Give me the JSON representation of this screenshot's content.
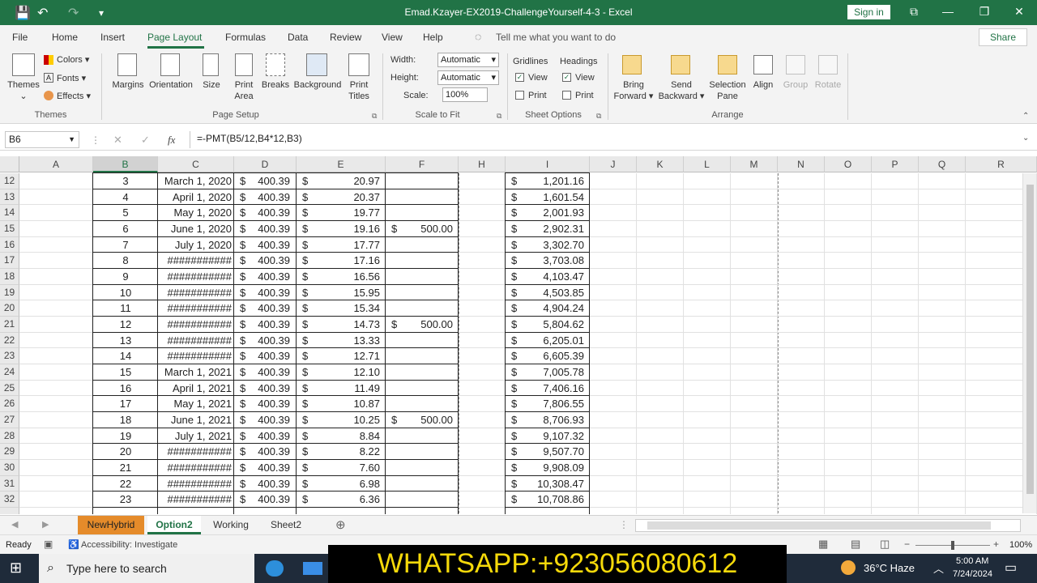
{
  "window": {
    "title": "Emad.Kzayer-EX2019-ChallengeYourself-4-3  -  Excel",
    "sign_in": "Sign in"
  },
  "tabs": [
    "File",
    "Home",
    "Insert",
    "Page Layout",
    "Formulas",
    "Data",
    "Review",
    "View",
    "Help"
  ],
  "tell_me": "Tell me what you want to do",
  "share": "Share",
  "ribbon": {
    "themes": {
      "themes": "Themes",
      "colors": "Colors",
      "fonts": "Fonts",
      "effects": "Effects",
      "group": "Themes"
    },
    "page_setup": {
      "margins": "Margins",
      "orientation": "Orientation",
      "size": "Size",
      "print_area_1": "Print",
      "print_area_2": "Area",
      "breaks": "Breaks",
      "background": "Background",
      "print_titles_1": "Print",
      "print_titles_2": "Titles",
      "group": "Page Setup"
    },
    "scale": {
      "width_label": "Width:",
      "width_value": "Automatic",
      "height_label": "Height:",
      "height_value": "Automatic",
      "scale_label": "Scale:",
      "scale_value": "100%",
      "group": "Scale to Fit"
    },
    "sheet_options": {
      "gridlines": "Gridlines",
      "headings": "Headings",
      "view": "View",
      "print": "Print",
      "group": "Sheet Options"
    },
    "arrange": {
      "bring_1": "Bring",
      "bring_2": "Forward",
      "send_1": "Send",
      "send_2": "Backward",
      "selection_1": "Selection",
      "selection_2": "Pane",
      "align": "Align",
      "group_btn": "Group",
      "rotate": "Rotate",
      "group": "Arrange"
    }
  },
  "formula_bar": {
    "name_box": "B6",
    "formula": "=-PMT(B5/12,B4*12,B3)",
    "cancel": "✕",
    "enter": "✓",
    "fx": "fx"
  },
  "columns": [
    "A",
    "B",
    "C",
    "D",
    "E",
    "F",
    "H",
    "I",
    "J",
    "K",
    "L",
    "M",
    "N",
    "O",
    "P",
    "Q",
    "R"
  ],
  "rows": [
    {
      "r": "12",
      "b": "3",
      "c": "March 1, 2020",
      "d": "400.39",
      "e": "20.97",
      "f": "",
      "i": "1,201.16"
    },
    {
      "r": "13",
      "b": "4",
      "c": "April 1, 2020",
      "d": "400.39",
      "e": "20.37",
      "f": "",
      "i": "1,601.54"
    },
    {
      "r": "14",
      "b": "5",
      "c": "May 1, 2020",
      "d": "400.39",
      "e": "19.77",
      "f": "",
      "i": "2,001.93"
    },
    {
      "r": "15",
      "b": "6",
      "c": "June 1, 2020",
      "d": "400.39",
      "e": "19.16",
      "f": "500.00",
      "i": "2,902.31"
    },
    {
      "r": "16",
      "b": "7",
      "c": "July 1, 2020",
      "d": "400.39",
      "e": "17.77",
      "f": "",
      "i": "3,302.70"
    },
    {
      "r": "17",
      "b": "8",
      "c": "###########",
      "d": "400.39",
      "e": "17.16",
      "f": "",
      "i": "3,703.08"
    },
    {
      "r": "18",
      "b": "9",
      "c": "###########",
      "d": "400.39",
      "e": "16.56",
      "f": "",
      "i": "4,103.47"
    },
    {
      "r": "19",
      "b": "10",
      "c": "###########",
      "d": "400.39",
      "e": "15.95",
      "f": "",
      "i": "4,503.85"
    },
    {
      "r": "20",
      "b": "11",
      "c": "###########",
      "d": "400.39",
      "e": "15.34",
      "f": "",
      "i": "4,904.24"
    },
    {
      "r": "21",
      "b": "12",
      "c": "###########",
      "d": "400.39",
      "e": "14.73",
      "f": "500.00",
      "i": "5,804.62"
    },
    {
      "r": "22",
      "b": "13",
      "c": "###########",
      "d": "400.39",
      "e": "13.33",
      "f": "",
      "i": "6,205.01"
    },
    {
      "r": "23",
      "b": "14",
      "c": "###########",
      "d": "400.39",
      "e": "12.71",
      "f": "",
      "i": "6,605.39"
    },
    {
      "r": "24",
      "b": "15",
      "c": "March 1, 2021",
      "d": "400.39",
      "e": "12.10",
      "f": "",
      "i": "7,005.78"
    },
    {
      "r": "25",
      "b": "16",
      "c": "April 1, 2021",
      "d": "400.39",
      "e": "11.49",
      "f": "",
      "i": "7,406.16"
    },
    {
      "r": "26",
      "b": "17",
      "c": "May 1, 2021",
      "d": "400.39",
      "e": "10.87",
      "f": "",
      "i": "7,806.55"
    },
    {
      "r": "27",
      "b": "18",
      "c": "June 1, 2021",
      "d": "400.39",
      "e": "10.25",
      "f": "500.00",
      "i": "8,706.93"
    },
    {
      "r": "28",
      "b": "19",
      "c": "July 1, 2021",
      "d": "400.39",
      "e": "8.84",
      "f": "",
      "i": "9,107.32"
    },
    {
      "r": "29",
      "b": "20",
      "c": "###########",
      "d": "400.39",
      "e": "8.22",
      "f": "",
      "i": "9,507.70"
    },
    {
      "r": "30",
      "b": "21",
      "c": "###########",
      "d": "400.39",
      "e": "7.60",
      "f": "",
      "i": "9,908.09"
    },
    {
      "r": "31",
      "b": "22",
      "c": "###########",
      "d": "400.39",
      "e": "6.98",
      "f": "",
      "i": "10,308.47"
    },
    {
      "r": "32",
      "b": "23",
      "c": "###########",
      "d": "400.39",
      "e": "6.36",
      "f": "",
      "i": "10,708.86"
    }
  ],
  "currency": "$",
  "sheets": [
    {
      "name": "NewHybrid",
      "color": "#e58b2a",
      "active": false
    },
    {
      "name": "Option2",
      "color": "#ffffff",
      "active": true
    },
    {
      "name": "Working",
      "color": "",
      "active": false
    },
    {
      "name": "Sheet2",
      "color": "",
      "active": false
    }
  ],
  "status": {
    "ready": "Ready",
    "accessibility": "Accessibility: Investigate",
    "zoom": "100%"
  },
  "taskbar": {
    "search": "Type here to search",
    "weather": "36°C  Haze",
    "time": "5:00 AM",
    "date": "7/24/2024"
  },
  "overlay": "WHATSAPP:+923056080612"
}
